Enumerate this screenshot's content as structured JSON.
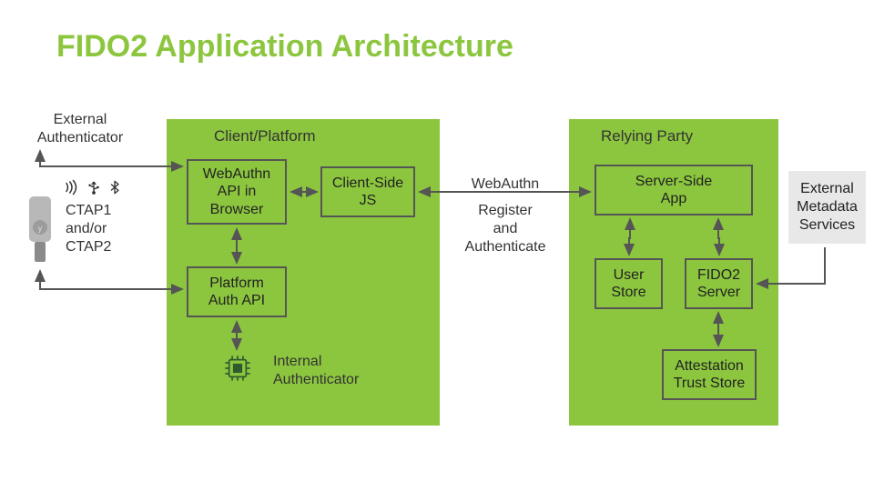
{
  "title": "FIDO2 Application Architecture",
  "labels": {
    "external_auth": "External\nAuthenticator",
    "ctap": "CTAP1\nand/or\nCTAP2",
    "internal_auth": "Internal\nAuthenticator",
    "webauthn": "WebAuthn",
    "register_auth": "Register\nand\nAuthenticate"
  },
  "panels": {
    "client_platform": "Client/Platform",
    "relying_party": "Relying Party"
  },
  "boxes": {
    "webauthn_api": "WebAuthn\nAPI in\nBrowser",
    "client_js": "Client-Side\nJS",
    "platform_auth": "Platform\nAuth API",
    "server_app": "Server-Side\nApp",
    "user_store": "User\nStore",
    "fido2_server": "FIDO2\nServer",
    "attestation": "Attestation\nTrust Store",
    "ext_metadata": "External\nMetadata\nServices"
  },
  "icons": {
    "nfc": "nfc",
    "usb": "usb",
    "bluetooth": "bluetooth",
    "chip": "chip",
    "hardware_key": "hardware-key"
  },
  "chart_data": {
    "type": "diagram",
    "title": "FIDO2 Application Architecture",
    "nodes": [
      {
        "id": "ext_auth",
        "label": "External Authenticator",
        "kind": "hardware",
        "protocols": [
          "NFC",
          "USB",
          "Bluetooth"
        ]
      },
      {
        "id": "ctap",
        "label": "CTAP1 and/or CTAP2",
        "kind": "protocol-label"
      },
      {
        "id": "webauthn_api",
        "label": "WebAuthn API in Browser",
        "group": "Client/Platform"
      },
      {
        "id": "client_js",
        "label": "Client-Side JS",
        "group": "Client/Platform"
      },
      {
        "id": "platform_auth",
        "label": "Platform Auth API",
        "group": "Client/Platform"
      },
      {
        "id": "internal_auth",
        "label": "Internal Authenticator",
        "group": "Client/Platform",
        "kind": "chip"
      },
      {
        "id": "server_app",
        "label": "Server-Side App",
        "group": "Relying Party"
      },
      {
        "id": "user_store",
        "label": "User Store",
        "group": "Relying Party"
      },
      {
        "id": "fido2_server",
        "label": "FIDO2 Server",
        "group": "Relying Party"
      },
      {
        "id": "attestation",
        "label": "Attestation Trust Store",
        "group": "Relying Party"
      },
      {
        "id": "ext_metadata",
        "label": "External Metadata Services",
        "kind": "external"
      }
    ],
    "groups": [
      "Client/Platform",
      "Relying Party"
    ],
    "edges": [
      {
        "from": "ext_auth",
        "to": "webauthn_api",
        "direction": "both",
        "via": "CTAP1 and/or CTAP2"
      },
      {
        "from": "ext_auth",
        "to": "platform_auth",
        "direction": "both",
        "via": "CTAP1 and/or CTAP2"
      },
      {
        "from": "webauthn_api",
        "to": "platform_auth",
        "direction": "both"
      },
      {
        "from": "webauthn_api",
        "to": "client_js",
        "direction": "both"
      },
      {
        "from": "platform_auth",
        "to": "internal_auth",
        "direction": "both"
      },
      {
        "from": "client_js",
        "to": "server_app",
        "direction": "both",
        "label": "WebAuthn / Register and Authenticate"
      },
      {
        "from": "server_app",
        "to": "user_store",
        "direction": "both"
      },
      {
        "from": "server_app",
        "to": "fido2_server",
        "direction": "both"
      },
      {
        "from": "fido2_server",
        "to": "attestation",
        "direction": "both"
      },
      {
        "from": "ext_metadata",
        "to": "fido2_server",
        "direction": "to"
      }
    ]
  }
}
